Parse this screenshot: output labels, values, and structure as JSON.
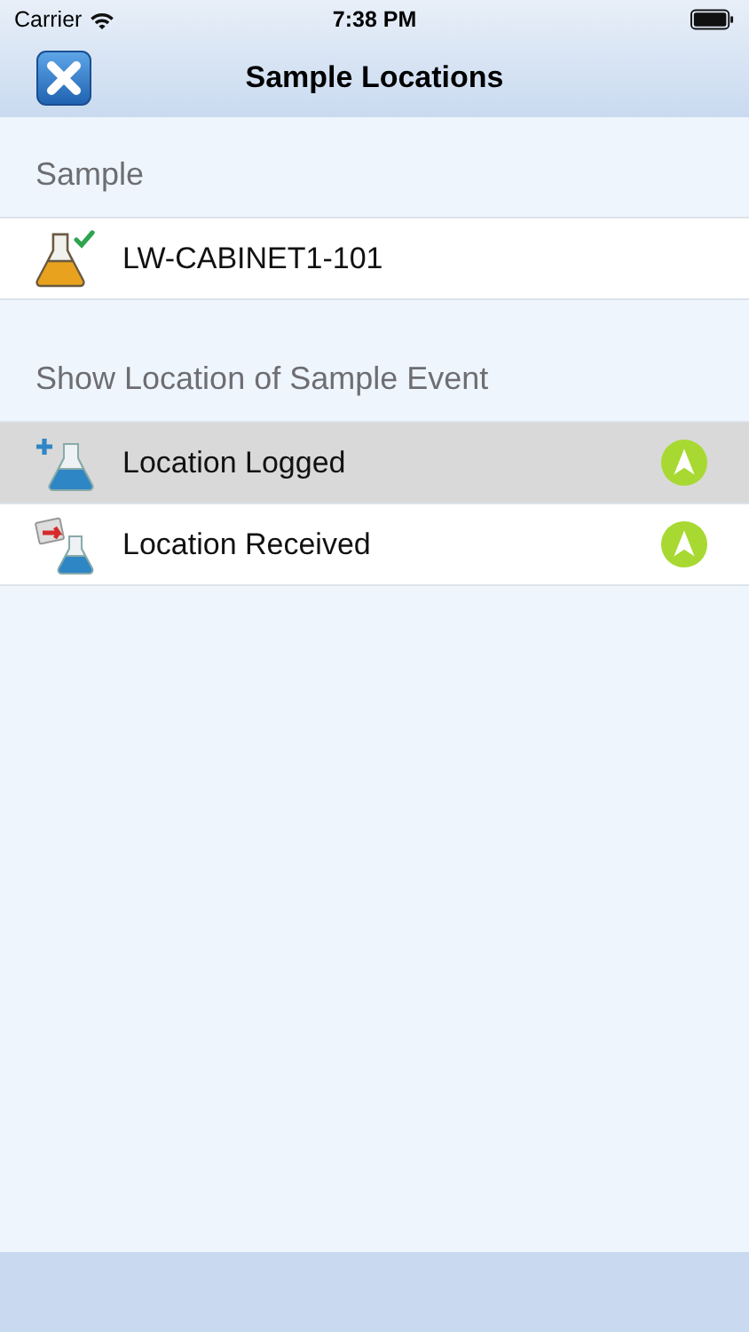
{
  "status_bar": {
    "carrier": "Carrier",
    "time": "7:38 PM"
  },
  "nav_bar": {
    "title": "Sample Locations"
  },
  "sections": [
    {
      "header": "Sample",
      "rows": [
        {
          "label": "LW-CABINET1-101",
          "kind": "sample",
          "selected": false,
          "navigate": false
        }
      ]
    },
    {
      "header": "Show Location of Sample Event",
      "rows": [
        {
          "label": "Location Logged",
          "kind": "logged",
          "selected": true,
          "navigate": true
        },
        {
          "label": "Location Received",
          "kind": "received",
          "selected": false,
          "navigate": true
        }
      ]
    }
  ]
}
